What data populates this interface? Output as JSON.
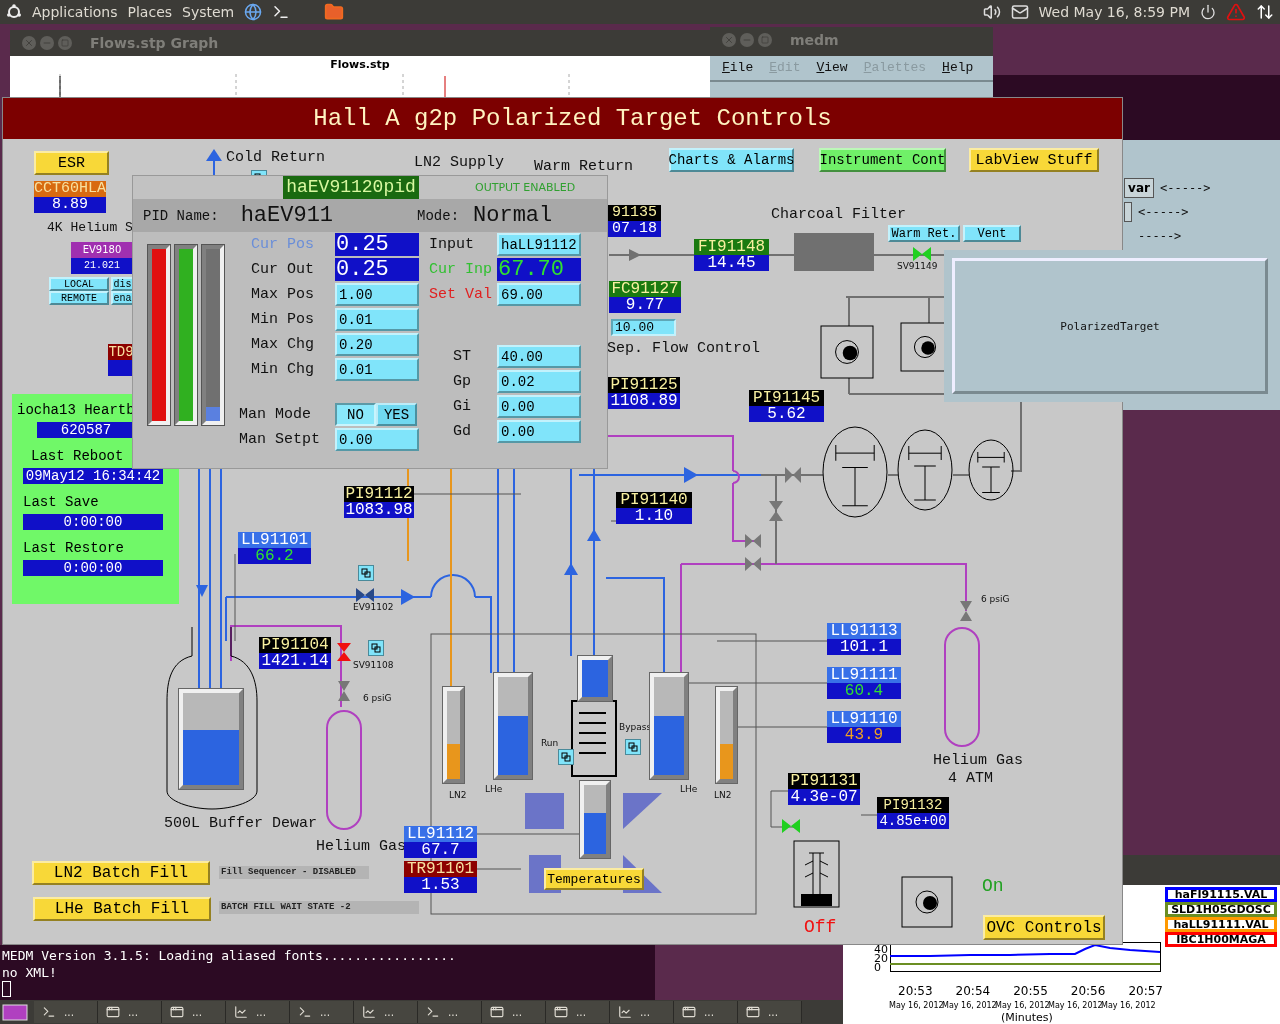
{
  "top_panel": {
    "menus": [
      "Applications",
      "Places",
      "System"
    ],
    "clock": "Wed May 16,  8:59 PM"
  },
  "flows_window": {
    "title": "Flows.stp Graph",
    "plot_title": "Flows.stp"
  },
  "medm_window": {
    "title": "medm",
    "menu": [
      {
        "label": "File",
        "disabled": false
      },
      {
        "label": "Edit",
        "disabled": true
      },
      {
        "label": "View",
        "disabled": false
      },
      {
        "label": "Palettes",
        "disabled": true
      },
      {
        "label": "Help",
        "disabled": false
      }
    ]
  },
  "side_window": {
    "button": "var",
    "arrows": [
      "<----->",
      "<----->",
      "----->"
    ]
  },
  "polarized_target_window": {
    "label": "PolarizedTarget"
  },
  "panel": {
    "title": "Hall A g2p Polarized Target Controls",
    "buttons": [
      {
        "label": "ESR",
        "color": "#f8d838"
      },
      {
        "label": "Charts & Alarms",
        "color": "#80e4fa"
      },
      {
        "label": "Instrument Cont",
        "color": "#70f068"
      },
      {
        "label": "LabView Stuff",
        "color": "#f8d838"
      },
      {
        "label": "LOCAL",
        "color": "#80e4fa"
      },
      {
        "label": "REMOTE",
        "color": "#80e4fa"
      },
      {
        "label": "dis",
        "color": "#80e4fa"
      },
      {
        "label": "ena",
        "color": "#80e4fa"
      },
      {
        "label": "Warm Ret.",
        "color": "#80e4fa"
      },
      {
        "label": "Vent",
        "color": "#80e4fa"
      },
      {
        "label": "Temperatures",
        "color": "#f8d838"
      },
      {
        "label": "LN2 Batch Fill",
        "color": "#f8d838"
      },
      {
        "label": "LHe Batch Fill",
        "color": "#f8d838"
      },
      {
        "label": "OVC Controls",
        "color": "#f8d838"
      }
    ],
    "labels": [
      "Cold Return",
      "LN2 Supply",
      "Warm Return",
      "4K Helium S",
      "Charcoal Filter",
      "Sep. Flow Control",
      "500L Buffer Dewar",
      "Helium Gas",
      "Helium Gas",
      "4 ATM",
      "LN2",
      "LHe",
      "LHe",
      "LN2",
      "Run",
      "Bypass",
      "6 psiG",
      "6 psiG",
      "EV91102",
      "SV91108",
      "SV91149"
    ],
    "readouts": [
      {
        "tag": "CCT60HLA",
        "kind": "sensor",
        "reading": {
          "text": "8.89",
          "kind": "plain"
        }
      },
      {
        "tag": "EV9180",
        "kind": "valve",
        "reading": {
          "text": "21.021",
          "kind": "plain"
        }
      },
      {
        "tag": "TD9",
        "kind": "temperature"
      },
      {
        "tag": "91135",
        "kind": "pressure",
        "reading": {
          "text": "07.18",
          "kind": "plain"
        }
      },
      {
        "tag": "FI91148",
        "kind": "flow",
        "reading": {
          "text": "14.45",
          "kind": "plain"
        }
      },
      {
        "tag": "FC91127",
        "kind": "flow",
        "reading": {
          "text": "9.77",
          "kind": "plain"
        }
      },
      {
        "tag": "PI91125",
        "kind": "pressure",
        "reading": {
          "text": "1108.89",
          "kind": "plain"
        }
      },
      {
        "tag": "PI91145",
        "kind": "pressure",
        "reading": {
          "text": "5.62",
          "kind": "plain"
        }
      },
      {
        "tag": "PI91112",
        "kind": "pressure",
        "reading": {
          "text": "1083.98",
          "kind": "plain"
        }
      },
      {
        "tag": "PI91140",
        "kind": "pressure",
        "reading": {
          "text": "1.10",
          "kind": "plain"
        }
      },
      {
        "tag": "LL91101",
        "kind": "level",
        "reading": {
          "text": "66.2",
          "kind": "normal"
        }
      },
      {
        "tag": "PI91104",
        "kind": "pressure",
        "reading": {
          "text": "1421.14",
          "kind": "plain"
        }
      },
      {
        "tag": "LL91112",
        "kind": "level",
        "reading": {
          "text": "67.7",
          "kind": "plain"
        }
      },
      {
        "tag": "TR91101",
        "kind": "temperature",
        "reading": {
          "text": "1.53",
          "kind": "plain"
        }
      },
      {
        "tag": "LL91113",
        "kind": "level",
        "reading": {
          "text": "101.1",
          "kind": "plain"
        }
      },
      {
        "tag": "LL91111",
        "kind": "level",
        "reading": {
          "text": "60.4",
          "kind": "normal"
        }
      },
      {
        "tag": "LL91110",
        "kind": "level",
        "reading": {
          "text": "43.9",
          "kind": "minor"
        }
      },
      {
        "tag": "PI91131",
        "kind": "pressure",
        "reading": {
          "text": "4.3e-07",
          "kind": "plain"
        }
      },
      {
        "tag": "PI91132",
        "kind": "pressure",
        "reading": {
          "text": "4.85e+00",
          "kind": "plain"
        }
      }
    ],
    "flow_setpoint": "10.00",
    "heartbeat": {
      "title": "iocha13 Heartb",
      "counter": "620587",
      "fields": [
        {
          "label": "Last Reboot",
          "value": "09May12 16:34:42"
        },
        {
          "label": "Last Save",
          "value": "0:00:00"
        },
        {
          "label": "Last Restore",
          "value": "0:00:00"
        }
      ]
    },
    "notices": [
      "Fill Sequencer - DISABLED",
      "BATCH FILL WAIT STATE -2"
    ],
    "valves": [
      {
        "color": "#2a4a88"
      },
      {
        "color": "#f01010"
      },
      {
        "color": "#20d020"
      },
      {
        "color": "#20d020"
      }
    ],
    "gauges": [
      {
        "level": 0.6,
        "kind": "lhe"
      },
      {
        "level": 0.4,
        "kind": "ln2"
      },
      {
        "level": 0.6,
        "kind": "lhe"
      },
      {
        "level": 1,
        "kind": "lhe"
      },
      {
        "level": 0.6,
        "kind": "lhe"
      },
      {
        "level": 0.6,
        "kind": "lhe"
      },
      {
        "level": 0.4,
        "kind": "ln2"
      }
    ],
    "pump_status": [
      {
        "text": "Off",
        "on": false
      },
      {
        "text": "On",
        "on": true
      }
    ]
  },
  "pid_popup": {
    "title": "haEV91120pid",
    "output_status": "OUTPUT ENABLED",
    "name_label": "PID Name:",
    "name": "haEV911",
    "mode_label": "Mode:",
    "mode": "Normal",
    "bars": [
      {
        "level": 1,
        "kind": "alarm"
      },
      {
        "level": 1,
        "kind": "ok"
      },
      {
        "level": 0.08,
        "kind": "position"
      }
    ],
    "left_rows": [
      {
        "label": "Cur Pos",
        "value": "0.25",
        "kind": "readback"
      },
      {
        "label": "Cur Out",
        "value": "0.25",
        "kind": "output"
      },
      {
        "label": "Max Pos",
        "value": "1.00",
        "kind": "entry"
      },
      {
        "label": "Min Pos",
        "value": "0.01",
        "kind": "entry"
      },
      {
        "label": "Max Chg",
        "value": "0.20",
        "kind": "entry"
      },
      {
        "label": "Min Chg",
        "value": "0.01",
        "kind": "entry"
      }
    ],
    "right_rows": [
      {
        "label": "Input",
        "value": "haLL91112",
        "kind": "entry"
      },
      {
        "label": "Cur Inp",
        "value": "67.70",
        "kind": "measured"
      },
      {
        "label": "Set Val",
        "value": "69.00",
        "kind": "setpoint"
      }
    ],
    "gains": [
      {
        "label": "ST",
        "value": "40.00"
      },
      {
        "label": "Gp",
        "value": "0.02"
      },
      {
        "label": "Gi",
        "value": "0.00"
      },
      {
        "label": "Gd",
        "value": "0.00"
      }
    ],
    "man_mode": {
      "label": "Man Mode",
      "options": [
        {
          "label": "NO",
          "selected": true
        },
        {
          "label": "YES",
          "selected": false
        }
      ]
    },
    "man_setpt": {
      "label": "Man Setpt",
      "value": "0.00"
    }
  },
  "terminal": {
    "lines": [
      "MEDM Version 3.1.5: Loading aliased fonts.................",
      "no XML!"
    ]
  },
  "strip_chart": {
    "legend": [
      {
        "label": "haFI91115.VAL",
        "color": "#0000ff"
      },
      {
        "label": "SLD1H05GDOSC",
        "color": "#6b8e23"
      },
      {
        "label": "haLL91111.VAL",
        "color": "#ff9900"
      },
      {
        "label": "IBC1H00MAGA",
        "color": "#ff0000"
      }
    ],
    "y_ticks": [
      "40",
      "20",
      "0"
    ],
    "x_ticks": [
      "20:53",
      "20:54",
      "20:55",
      "20:56",
      "20:57"
    ],
    "dates": [
      "May 16, 2012",
      "May 16, 2012",
      "May 16, 2012",
      "May 16, 2012",
      "May 16, 2012"
    ],
    "xlabel": "(Minutes)"
  },
  "taskbar": [
    {
      "kind": "terminal",
      "label": "..."
    },
    {
      "kind": "window",
      "label": "..."
    },
    {
      "kind": "window",
      "label": "..."
    },
    {
      "kind": "chart",
      "label": "..."
    },
    {
      "kind": "terminal",
      "label": "..."
    },
    {
      "kind": "chart",
      "label": "..."
    },
    {
      "kind": "terminal",
      "label": "..."
    },
    {
      "kind": "window",
      "label": "..."
    },
    {
      "kind": "window",
      "label": "..."
    },
    {
      "kind": "chart",
      "label": "..."
    },
    {
      "kind": "window",
      "label": "..."
    },
    {
      "kind": "window",
      "label": "..."
    }
  ]
}
